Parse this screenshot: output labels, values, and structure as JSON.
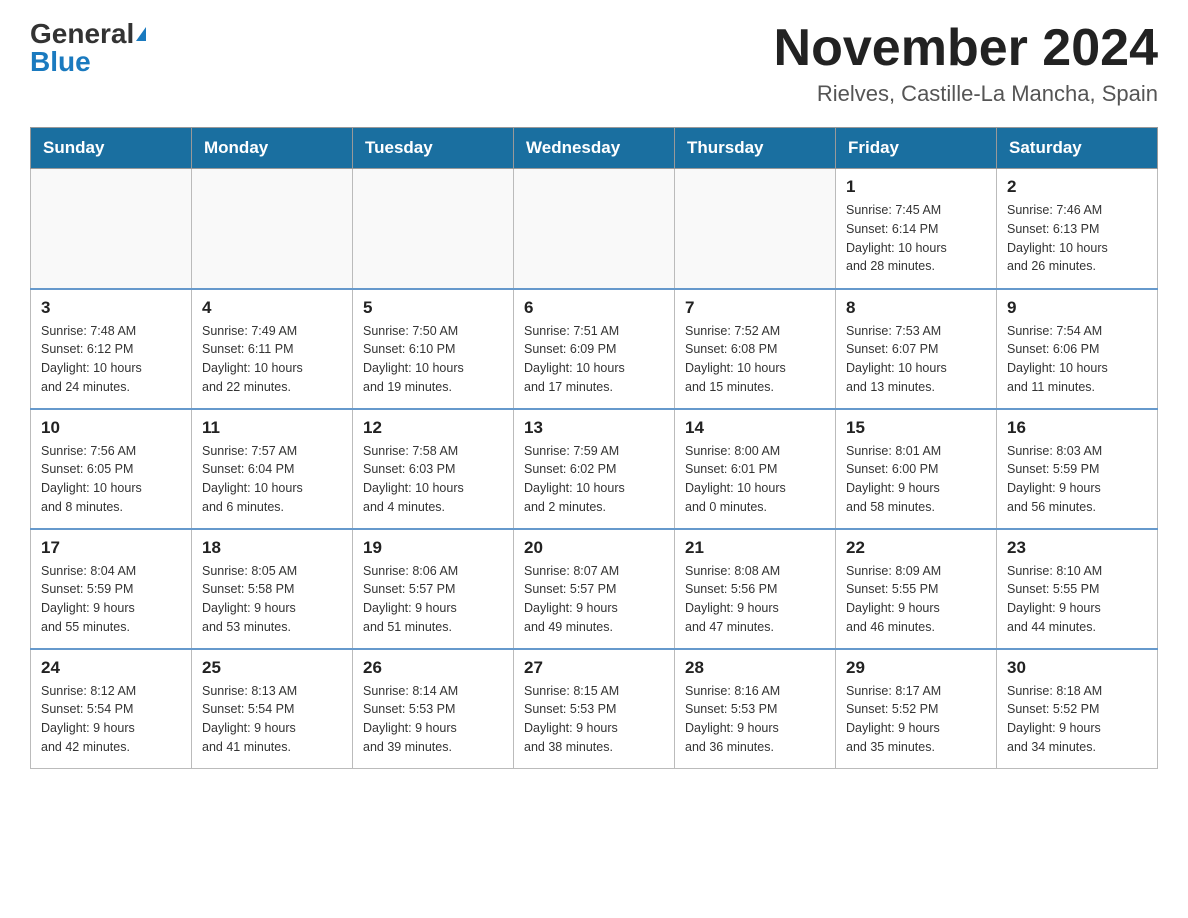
{
  "header": {
    "logo_general": "General",
    "logo_blue": "Blue",
    "month_title": "November 2024",
    "location": "Rielves, Castille-La Mancha, Spain"
  },
  "weekdays": [
    "Sunday",
    "Monday",
    "Tuesday",
    "Wednesday",
    "Thursday",
    "Friday",
    "Saturday"
  ],
  "weeks": [
    [
      {
        "day": "",
        "info": ""
      },
      {
        "day": "",
        "info": ""
      },
      {
        "day": "",
        "info": ""
      },
      {
        "day": "",
        "info": ""
      },
      {
        "day": "",
        "info": ""
      },
      {
        "day": "1",
        "info": "Sunrise: 7:45 AM\nSunset: 6:14 PM\nDaylight: 10 hours\nand 28 minutes."
      },
      {
        "day": "2",
        "info": "Sunrise: 7:46 AM\nSunset: 6:13 PM\nDaylight: 10 hours\nand 26 minutes."
      }
    ],
    [
      {
        "day": "3",
        "info": "Sunrise: 7:48 AM\nSunset: 6:12 PM\nDaylight: 10 hours\nand 24 minutes."
      },
      {
        "day": "4",
        "info": "Sunrise: 7:49 AM\nSunset: 6:11 PM\nDaylight: 10 hours\nand 22 minutes."
      },
      {
        "day": "5",
        "info": "Sunrise: 7:50 AM\nSunset: 6:10 PM\nDaylight: 10 hours\nand 19 minutes."
      },
      {
        "day": "6",
        "info": "Sunrise: 7:51 AM\nSunset: 6:09 PM\nDaylight: 10 hours\nand 17 minutes."
      },
      {
        "day": "7",
        "info": "Sunrise: 7:52 AM\nSunset: 6:08 PM\nDaylight: 10 hours\nand 15 minutes."
      },
      {
        "day": "8",
        "info": "Sunrise: 7:53 AM\nSunset: 6:07 PM\nDaylight: 10 hours\nand 13 minutes."
      },
      {
        "day": "9",
        "info": "Sunrise: 7:54 AM\nSunset: 6:06 PM\nDaylight: 10 hours\nand 11 minutes."
      }
    ],
    [
      {
        "day": "10",
        "info": "Sunrise: 7:56 AM\nSunset: 6:05 PM\nDaylight: 10 hours\nand 8 minutes."
      },
      {
        "day": "11",
        "info": "Sunrise: 7:57 AM\nSunset: 6:04 PM\nDaylight: 10 hours\nand 6 minutes."
      },
      {
        "day": "12",
        "info": "Sunrise: 7:58 AM\nSunset: 6:03 PM\nDaylight: 10 hours\nand 4 minutes."
      },
      {
        "day": "13",
        "info": "Sunrise: 7:59 AM\nSunset: 6:02 PM\nDaylight: 10 hours\nand 2 minutes."
      },
      {
        "day": "14",
        "info": "Sunrise: 8:00 AM\nSunset: 6:01 PM\nDaylight: 10 hours\nand 0 minutes."
      },
      {
        "day": "15",
        "info": "Sunrise: 8:01 AM\nSunset: 6:00 PM\nDaylight: 9 hours\nand 58 minutes."
      },
      {
        "day": "16",
        "info": "Sunrise: 8:03 AM\nSunset: 5:59 PM\nDaylight: 9 hours\nand 56 minutes."
      }
    ],
    [
      {
        "day": "17",
        "info": "Sunrise: 8:04 AM\nSunset: 5:59 PM\nDaylight: 9 hours\nand 55 minutes."
      },
      {
        "day": "18",
        "info": "Sunrise: 8:05 AM\nSunset: 5:58 PM\nDaylight: 9 hours\nand 53 minutes."
      },
      {
        "day": "19",
        "info": "Sunrise: 8:06 AM\nSunset: 5:57 PM\nDaylight: 9 hours\nand 51 minutes."
      },
      {
        "day": "20",
        "info": "Sunrise: 8:07 AM\nSunset: 5:57 PM\nDaylight: 9 hours\nand 49 minutes."
      },
      {
        "day": "21",
        "info": "Sunrise: 8:08 AM\nSunset: 5:56 PM\nDaylight: 9 hours\nand 47 minutes."
      },
      {
        "day": "22",
        "info": "Sunrise: 8:09 AM\nSunset: 5:55 PM\nDaylight: 9 hours\nand 46 minutes."
      },
      {
        "day": "23",
        "info": "Sunrise: 8:10 AM\nSunset: 5:55 PM\nDaylight: 9 hours\nand 44 minutes."
      }
    ],
    [
      {
        "day": "24",
        "info": "Sunrise: 8:12 AM\nSunset: 5:54 PM\nDaylight: 9 hours\nand 42 minutes."
      },
      {
        "day": "25",
        "info": "Sunrise: 8:13 AM\nSunset: 5:54 PM\nDaylight: 9 hours\nand 41 minutes."
      },
      {
        "day": "26",
        "info": "Sunrise: 8:14 AM\nSunset: 5:53 PM\nDaylight: 9 hours\nand 39 minutes."
      },
      {
        "day": "27",
        "info": "Sunrise: 8:15 AM\nSunset: 5:53 PM\nDaylight: 9 hours\nand 38 minutes."
      },
      {
        "day": "28",
        "info": "Sunrise: 8:16 AM\nSunset: 5:53 PM\nDaylight: 9 hours\nand 36 minutes."
      },
      {
        "day": "29",
        "info": "Sunrise: 8:17 AM\nSunset: 5:52 PM\nDaylight: 9 hours\nand 35 minutes."
      },
      {
        "day": "30",
        "info": "Sunrise: 8:18 AM\nSunset: 5:52 PM\nDaylight: 9 hours\nand 34 minutes."
      }
    ]
  ]
}
